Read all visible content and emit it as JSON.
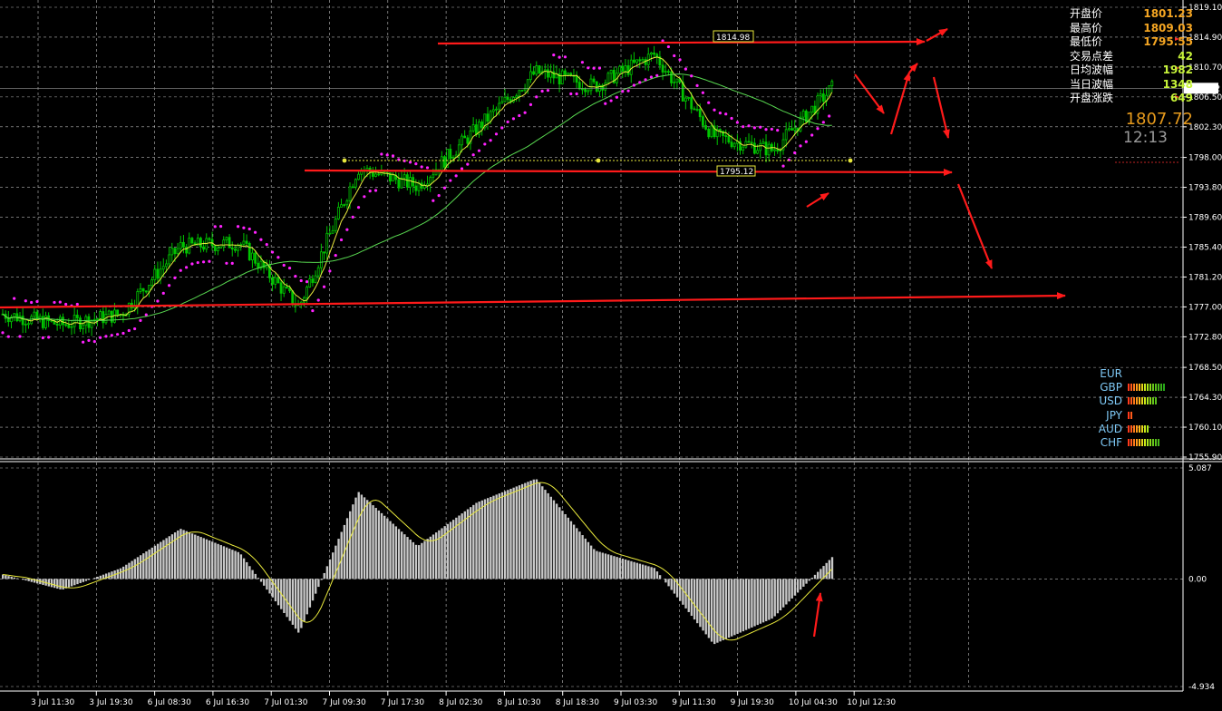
{
  "price_axis": {
    "labels": [
      "1819.10",
      "1814.90",
      "1810.70",
      "1806.50",
      "1802.30",
      "1798.00",
      "1793.80",
      "1789.60",
      "1785.40",
      "1781.20",
      "1777.00",
      "1772.80",
      "1768.50",
      "1764.30",
      "1760.10",
      "1755.90"
    ],
    "current_price_tag": "1807.72"
  },
  "macd_axis": {
    "labels": [
      "5.087",
      "0.00",
      "-4.934"
    ]
  },
  "time_axis": {
    "labels": [
      "3 Jul 11:30",
      "3 Jul 19:30",
      "6 Jul 08:30",
      "6 Jul 16:30",
      "7 Jul 01:30",
      "7 Jul 09:30",
      "7 Jul 17:30",
      "8 Jul 02:30",
      "8 Jul 10:30",
      "8 Jul 18:30",
      "9 Jul 03:30",
      "9 Jul 11:30",
      "9 Jul 19:30",
      "10 Jul 04:30",
      "10 Jul 12:30"
    ]
  },
  "level_labels": {
    "upper": "1814.98",
    "lower": "1795.12"
  },
  "info_panel": [
    {
      "label": "开盘价",
      "value": "1801.23",
      "color": "#f5a623"
    },
    {
      "label": "最高价",
      "value": "1809.03",
      "color": "#f5a623"
    },
    {
      "label": "最低价",
      "value": "1795.55",
      "color": "#f5a623"
    },
    {
      "label": "交易点差",
      "value": "42",
      "color": "#c8f53a"
    },
    {
      "label": "日均波幅",
      "value": "1982",
      "color": "#c8f53a"
    },
    {
      "label": "当日波幅",
      "value": "1348",
      "color": "#c8f53a"
    },
    {
      "label": "开盘涨跌",
      "value": "649",
      "color": "#c8f53a"
    }
  ],
  "last_price": "1807.72",
  "countdown": "12:13",
  "currency_strength": [
    {
      "name": "EUR",
      "strength": 0
    },
    {
      "name": "GBP",
      "strength": 14
    },
    {
      "name": "USD",
      "strength": 11
    },
    {
      "name": "JPY",
      "strength": 2
    },
    {
      "name": "AUD",
      "strength": 8
    },
    {
      "name": "CHF",
      "strength": 12
    }
  ],
  "colors": {
    "background": "#000000",
    "grid": "#ffffff",
    "candle_up": "#00c400",
    "candle_down": "#00c400",
    "sar": "#ff22ff",
    "ma_fast": "#e8e83c",
    "ma_slow": "#58d850",
    "annotation": "#ff1a1a",
    "macd_hist": "#c8c8c8",
    "macd_signal": "#e8e83c"
  },
  "chart_data": {
    "type": "candlestick",
    "symbol": "",
    "ylim": [
      1755.9,
      1819.1
    ],
    "close_path": [
      [
        "3 Jul 11:30",
        1776.0
      ],
      [
        "3 Jul 19:30",
        1774.5
      ],
      [
        "6 Jul 08:30",
        1776.0
      ],
      [
        "6 Jul 16:30",
        1785.5
      ],
      [
        "7 Jul 01:30",
        1786.0
      ],
      [
        "7 Jul 09:30",
        1777.0
      ],
      [
        "7 Jul 17:30",
        1796.5
      ],
      [
        "8 Jul 02:30",
        1794.0
      ],
      [
        "8 Jul 10:30",
        1802.0
      ],
      [
        "8 Jul 18:30",
        1810.0
      ],
      [
        "9 Jul 03:30",
        1808.0
      ],
      [
        "9 Jul 11:30",
        1812.5
      ],
      [
        "9 Jul 19:30",
        1801.0
      ],
      [
        "10 Jul 04:30",
        1799.0
      ],
      [
        "10 Jul 12:30",
        1807.72
      ]
    ],
    "macd": {
      "ylim": [
        -4.934,
        5.087
      ],
      "histogram_path": [
        [
          "3 Jul 11:30",
          0.2
        ],
        [
          "3 Jul 19:30",
          -0.5
        ],
        [
          "6 Jul 08:30",
          0.5
        ],
        [
          "6 Jul 16:30",
          2.3
        ],
        [
          "7 Jul 01:30",
          1.2
        ],
        [
          "7 Jul 09:30",
          -2.5
        ],
        [
          "7 Jul 17:30",
          4.0
        ],
        [
          "8 Jul 02:30",
          1.5
        ],
        [
          "8 Jul 10:30",
          3.5
        ],
        [
          "8 Jul 18:30",
          4.6
        ],
        [
          "9 Jul 03:30",
          1.3
        ],
        [
          "9 Jul 11:30",
          0.5
        ],
        [
          "9 Jul 19:30",
          -3.0
        ],
        [
          "10 Jul 04:30",
          -1.8
        ],
        [
          "10 Jul 12:30",
          1.0
        ]
      ]
    }
  }
}
